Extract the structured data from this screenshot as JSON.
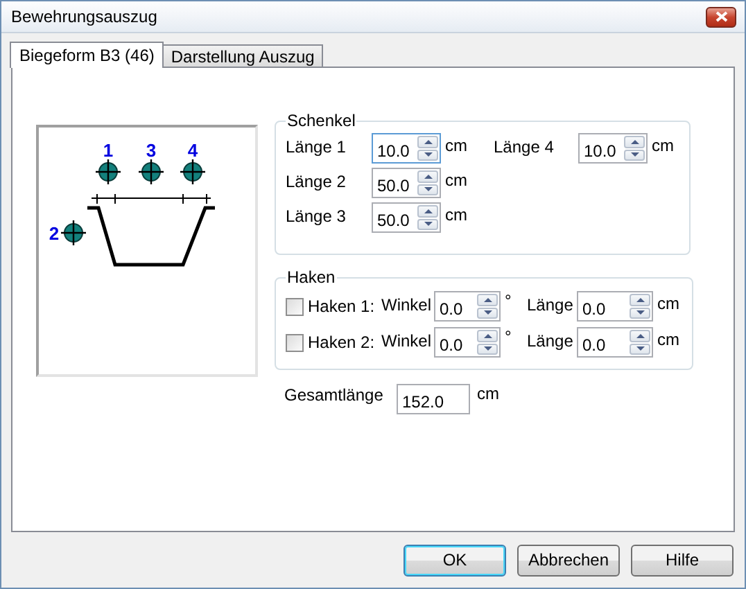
{
  "window": {
    "title": "Bewehrungsauszug"
  },
  "tabs": [
    {
      "label": "Biegeform B3 (46)",
      "selected": true
    },
    {
      "label": "Darstellung Auszug",
      "selected": false
    }
  ],
  "drawing": {
    "markers": [
      "1",
      "3",
      "4",
      "2"
    ]
  },
  "schenkel": {
    "title": "Schenkel",
    "lengths": [
      {
        "label": "Länge 1",
        "value": "10.0",
        "unit": "cm",
        "focused": true
      },
      {
        "label": "Länge 2",
        "value": "50.0",
        "unit": "cm",
        "focused": false
      },
      {
        "label": "Länge 3",
        "value": "50.0",
        "unit": "cm",
        "focused": false
      },
      {
        "label": "Länge 4",
        "value": "10.0",
        "unit": "cm",
        "focused": false
      }
    ]
  },
  "haken": {
    "title": "Haken",
    "rows": [
      {
        "label": "Haken 1:",
        "checked": false,
        "angle_label": "Winkel",
        "angle": "0.0",
        "angle_unit": "°",
        "length_label": "Länge",
        "length": "0.0",
        "length_unit": "cm"
      },
      {
        "label": "Haken 2:",
        "checked": false,
        "angle_label": "Winkel",
        "angle": "0.0",
        "angle_unit": "°",
        "length_label": "Länge",
        "length": "0.0",
        "length_unit": "cm"
      }
    ]
  },
  "total": {
    "label": "Gesamtlänge",
    "value": "152.0",
    "unit": "cm"
  },
  "buttons": [
    {
      "label": "OK",
      "default": true
    },
    {
      "label": "Abbrechen",
      "default": false
    },
    {
      "label": "Hilfe",
      "default": false
    }
  ]
}
